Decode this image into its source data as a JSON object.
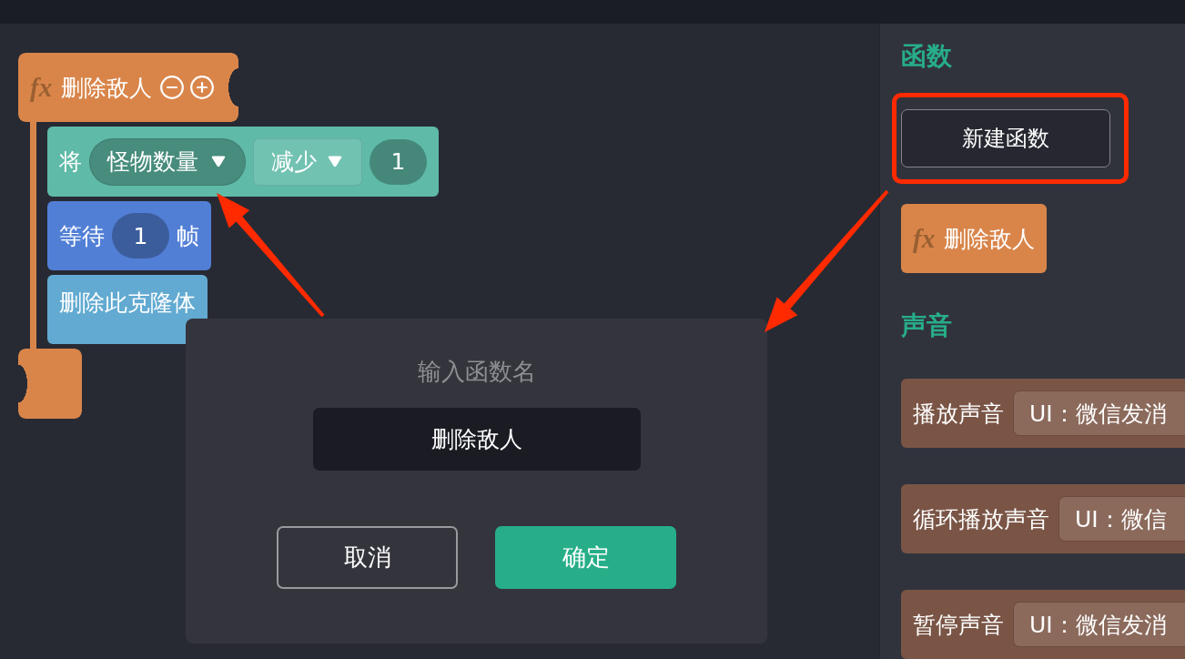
{
  "workspace": {
    "script": {
      "hat": {
        "icon": "fx",
        "label": "删除敌人"
      },
      "blocks": [
        {
          "kind": "change",
          "color": "#5fbaa7",
          "parts": [
            {
              "kind": "label",
              "text": "将"
            },
            {
              "kind": "variable_dropdown",
              "text": "怪物数量"
            },
            {
              "kind": "operator_dropdown",
              "text": "减少"
            },
            {
              "kind": "number",
              "text": "1"
            }
          ]
        },
        {
          "kind": "wait",
          "color": "#527fd6",
          "parts": [
            {
              "kind": "label",
              "text": "等待"
            },
            {
              "kind": "number",
              "text": "1"
            },
            {
              "kind": "label",
              "text": "帧"
            }
          ]
        },
        {
          "kind": "action",
          "color": "#62aad1",
          "parts": [
            {
              "kind": "label",
              "text": "删除此克隆体"
            }
          ]
        }
      ]
    }
  },
  "dialog": {
    "title": "输入函数名",
    "input": {
      "value": "删除敌人"
    },
    "buttons": [
      {
        "kind": "secondary",
        "label": "取消"
      },
      {
        "kind": "primary",
        "label": "确定"
      }
    ]
  },
  "palette": {
    "sections": [
      {
        "title": "函数",
        "items": [
          {
            "kind": "button",
            "label": "新建函数",
            "highlighted": true
          },
          {
            "kind": "function_block",
            "icon": "fx",
            "label": "删除敌人"
          }
        ]
      },
      {
        "title": "声音",
        "items": [
          {
            "kind": "sound_block",
            "label": "播放声音",
            "value": "UI：微信发消"
          },
          {
            "kind": "sound_block",
            "label": "循环播放声音",
            "value": "UI：微信"
          },
          {
            "kind": "sound_block",
            "label": "暂停声音",
            "value": "UI：微信发消"
          }
        ]
      }
    ]
  }
}
